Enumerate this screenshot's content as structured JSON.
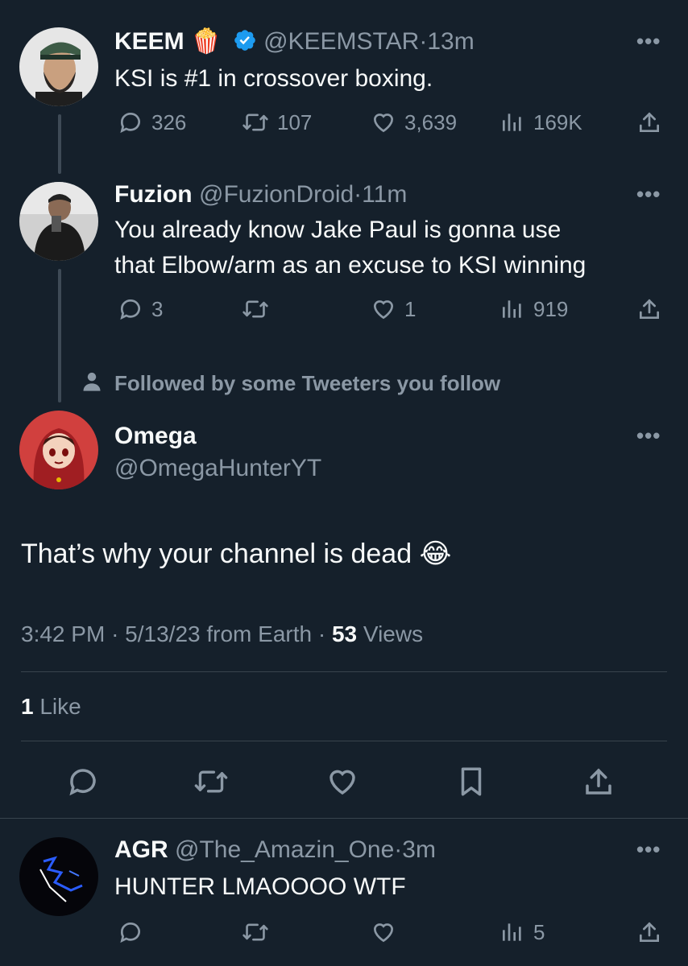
{
  "tweets": [
    {
      "name": "KEEM",
      "emoji": "🍿",
      "handle": "@KEEMSTAR",
      "time": "13m",
      "text": "KSI is #1 in crossover boxing.",
      "replies": "326",
      "retweets": "107",
      "likes": "3,639",
      "views": "169K"
    },
    {
      "name": "Fuzion",
      "handle": "@FuzionDroid",
      "time": "11m",
      "text_line1": "You already know Jake Paul is gonna use",
      "text_line2": "that Elbow/arm as an excuse to KSI winning",
      "replies": "3",
      "retweets": "",
      "likes": "1",
      "views": "919"
    }
  ],
  "social_context": "Followed by some Tweeters you follow",
  "focused": {
    "name": "Omega",
    "handle": "@OmegaHunterYT",
    "text": "That’s why your channel is dead",
    "emoji": "😂",
    "time": "3:42 PM",
    "date": "5/13/23 from Earth",
    "views_count": "53",
    "views_label": "Views",
    "likes_count": "1",
    "likes_label": "Like"
  },
  "reply": {
    "name": "AGR",
    "handle": "@The_Amazin_One",
    "time": "3m",
    "text": "HUNTER LMAOOOO WTF",
    "views": "5"
  },
  "separator": "·",
  "more_label": "•••",
  "colors": {
    "background": "#15202b",
    "text": "#f7f9f9",
    "secondary": "#8b98a5",
    "verified": "#1d9bf0",
    "divider": "#38444d"
  },
  "icons": [
    "reply-icon",
    "retweet-icon",
    "like-icon",
    "views-icon",
    "share-icon",
    "bookmark-icon",
    "verified-icon",
    "person-icon"
  ]
}
